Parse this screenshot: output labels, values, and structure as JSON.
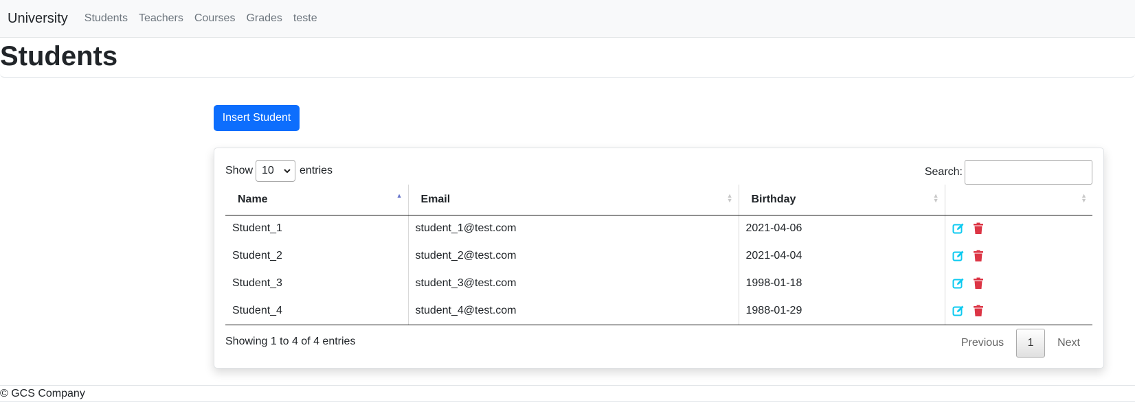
{
  "navbar": {
    "brand": "University",
    "links": [
      "Students",
      "Teachers",
      "Courses",
      "Grades",
      "teste"
    ]
  },
  "page": {
    "title": "Students"
  },
  "insert_button": "Insert Student",
  "table_controls": {
    "show_label": "Show",
    "entries_label": "entries",
    "length_value": "10",
    "search_label": "Search:",
    "search_value": ""
  },
  "table": {
    "headers": [
      "Name",
      "Email",
      "Birthday",
      ""
    ],
    "sorted_column": "Name",
    "sort_direction": "asc",
    "rows": [
      {
        "name": "Student_1",
        "email": "student_1@test.com",
        "birthday": "2021-04-06"
      },
      {
        "name": "Student_2",
        "email": "student_2@test.com",
        "birthday": "2021-04-04"
      },
      {
        "name": "Student_3",
        "email": "student_3@test.com",
        "birthday": "1998-01-18"
      },
      {
        "name": "Student_4",
        "email": "student_4@test.com",
        "birthday": "1988-01-29"
      }
    ]
  },
  "info": "Showing 1 to 4 of 4 entries",
  "pagination": {
    "previous": "Previous",
    "current": "1",
    "next": "Next"
  },
  "footer": "© GCS Company",
  "colors": {
    "primary": "#0d6efd",
    "edit_icon": "#0dcaf0",
    "delete_icon": "#dc3545",
    "sort_active": "#6573c9"
  },
  "icons": {
    "edit": "edit-icon",
    "delete": "trash-icon"
  }
}
